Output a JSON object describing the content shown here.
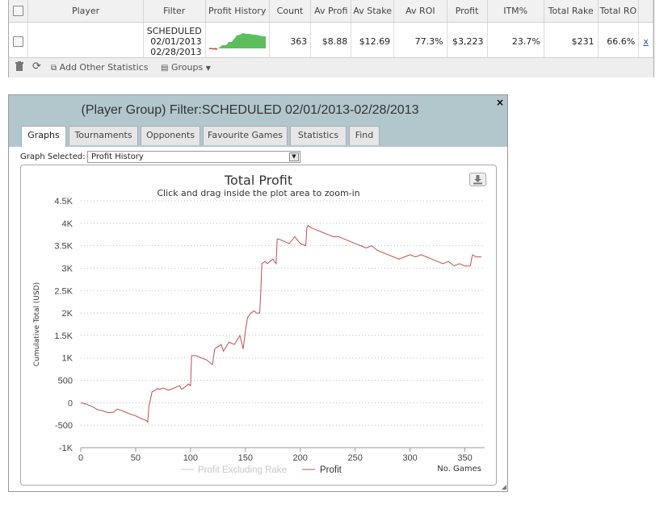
{
  "stats_table": {
    "columns": [
      "Player",
      "Filter",
      "Profit History",
      "Count",
      "Av Profi",
      "Av Stake",
      "Av ROI",
      "Profit",
      "ITM%",
      "Total Rake",
      "Total RO"
    ],
    "row": {
      "filter_lines": [
        "SCHEDULED",
        "02/01/2013",
        "02/28/2013"
      ],
      "count": "363",
      "av_profit": "$8.88",
      "av_stake": "$12.69",
      "av_roi": "77.3%",
      "profit": "$3,223",
      "itm": "23.7%",
      "total_rake": "$231",
      "total_roi": "66.6%",
      "close_label": "x"
    },
    "footer": {
      "delete_icon": "trash-icon",
      "refresh_icon": "refresh-icon",
      "add_stats_label": "Add Other Statistics",
      "groups_label": "Groups"
    }
  },
  "dialog": {
    "title": "(Player Group) Filter:SCHEDULED 02/01/2013-02/28/2013",
    "close_label": "×",
    "tabs": [
      "Graphs",
      "Tournaments",
      "Opponents",
      "Favourite Games",
      "Statistics",
      "Find"
    ],
    "active_tab": "Graphs",
    "graph_selected_label": "Graph Selected:",
    "graph_selected_value": "Profit History"
  },
  "chart_data": {
    "type": "line",
    "title": "Total Profit",
    "subtitle": "Click and drag inside the plot area to zoom-in",
    "xlabel": "No. Games",
    "ylabel": "Cumulative Total (USD)",
    "xlim": [
      0,
      368
    ],
    "ylim": [
      -1000,
      4500
    ],
    "x_ticks": [
      0,
      50,
      100,
      150,
      200,
      250,
      300,
      350
    ],
    "y_ticks": [
      -1000,
      -500,
      0,
      500,
      1000,
      1500,
      2000,
      2500,
      3000,
      3500,
      4000,
      4500
    ],
    "y_tick_labels": [
      "-1K",
      "-500",
      "0",
      "500",
      "1K",
      "1.5K",
      "2K",
      "2.5K",
      "3K",
      "3.5K",
      "4K",
      "4.5K"
    ],
    "grid": true,
    "legend": "bottom-center",
    "legend_entries": [
      {
        "name": "Profit Excluding Rake",
        "color": "#cccccc",
        "hidden": true
      },
      {
        "name": "Profit",
        "color": "#c0504d",
        "hidden": false
      }
    ],
    "series": [
      {
        "name": "Profit",
        "color": "#c0504d",
        "x": [
          0,
          5,
          10,
          15,
          20,
          25,
          30,
          33,
          36,
          40,
          45,
          50,
          55,
          60,
          61,
          62,
          65,
          68,
          70,
          72,
          75,
          80,
          85,
          90,
          92,
          95,
          98,
          100,
          101,
          105,
          110,
          115,
          120,
          122,
          125,
          128,
          130,
          135,
          140,
          145,
          148,
          150,
          152,
          155,
          158,
          160,
          163,
          164,
          165,
          168,
          170,
          175,
          178,
          179,
          180,
          185,
          190,
          195,
          200,
          205,
          206,
          207,
          210,
          215,
          220,
          225,
          230,
          235,
          240,
          245,
          250,
          255,
          260,
          265,
          270,
          275,
          280,
          285,
          290,
          295,
          300,
          305,
          310,
          315,
          320,
          325,
          330,
          335,
          340,
          345,
          350,
          355,
          356,
          357,
          360,
          365
        ],
        "y": [
          0,
          -30,
          -80,
          -150,
          -180,
          -220,
          -210,
          -140,
          -160,
          -200,
          -250,
          -290,
          -350,
          -400,
          -430,
          -100,
          250,
          280,
          320,
          300,
          330,
          280,
          330,
          380,
          300,
          350,
          420,
          380,
          1050,
          1050,
          1000,
          950,
          850,
          1200,
          1250,
          1300,
          1150,
          1350,
          1300,
          1500,
          1200,
          1600,
          1900,
          2000,
          2050,
          2000,
          2000,
          2450,
          3100,
          3150,
          3100,
          3200,
          3100,
          3650,
          3650,
          3600,
          3550,
          3700,
          3550,
          3500,
          3900,
          3950,
          3900,
          3850,
          3800,
          3750,
          3700,
          3700,
          3650,
          3600,
          3550,
          3500,
          3450,
          3500,
          3400,
          3350,
          3300,
          3250,
          3200,
          3250,
          3300,
          3250,
          3300,
          3250,
          3200,
          3150,
          3100,
          3150,
          3050,
          3100,
          3050,
          3050,
          3200,
          3300,
          3250,
          3250
        ]
      }
    ]
  }
}
